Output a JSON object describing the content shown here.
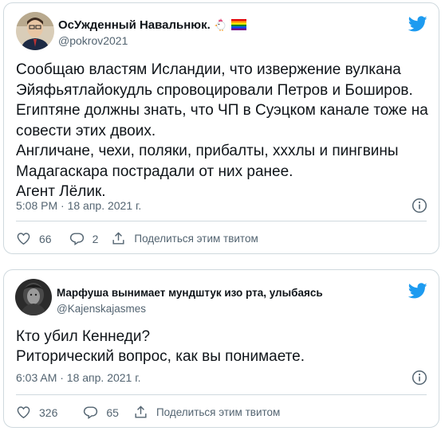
{
  "tweets": [
    {
      "author_name": "ОсУжденный Навальнюк.",
      "handle": "@pokrov2021",
      "text_lines": [
        "Сообщаю властям Исландии, что извержение вулкана",
        "Эйяфьятлайокудль спровоцировали Петров и Боширов.",
        "Египтяне должны знать, что ЧП в Суэцком канале тоже на",
        "совести этих двоих.",
        "Англичане, чехи, поляки, прибалты, хххлы и пингвины",
        "Мадагаскара пострадали от них ранее.",
        "Агент Лёлик."
      ],
      "timestamp": "5:08 PM · 18 апр. 2021 г.",
      "likes": "66",
      "replies": "2",
      "share_label": "Поделиться этим твитом"
    },
    {
      "author_name": "Марфуша вынимает мундштук изо рта, улыбаясь",
      "handle": "@Kajenskajasmes",
      "text_lines": [
        "Кто убил Кеннеди?",
        "Риторический вопрос, как вы понимаете."
      ],
      "timestamp": "6:03 AM · 18 апр. 2021 г.",
      "likes": "326",
      "replies": "65",
      "share_label": "Поделиться этим твитом"
    }
  ],
  "icons": {
    "brand": "twitter-bird-icon",
    "info": "info-icon",
    "like": "heart-icon",
    "reply": "reply-bubble-icon",
    "share": "share-icon",
    "emoji_1": "rooster-emoji",
    "emoji_2": "rainbow-flag-emoji"
  },
  "colors": {
    "twitter_blue": "#1d9bf0",
    "text": "#0f1419",
    "secondary": "#536471",
    "border": "#cfd9de"
  }
}
